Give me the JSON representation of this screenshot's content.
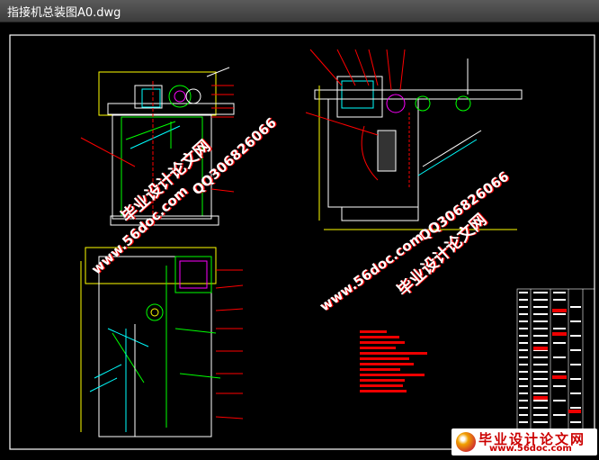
{
  "window": {
    "title": "指接机总装图A0.dwg"
  },
  "watermarks": {
    "site_name": "毕业设计论文网",
    "site_url": "www.56doc.com",
    "qq": "QQ306826066"
  },
  "logo": {
    "name": "毕业设计论文网",
    "url": "www.56doc.com"
  },
  "colors": {
    "background": "#000000",
    "border": "#ffffff",
    "lines": "#00ff00",
    "annotation": "#ff0000",
    "dimension": "#ffff00",
    "watermark": "#ffffff"
  }
}
